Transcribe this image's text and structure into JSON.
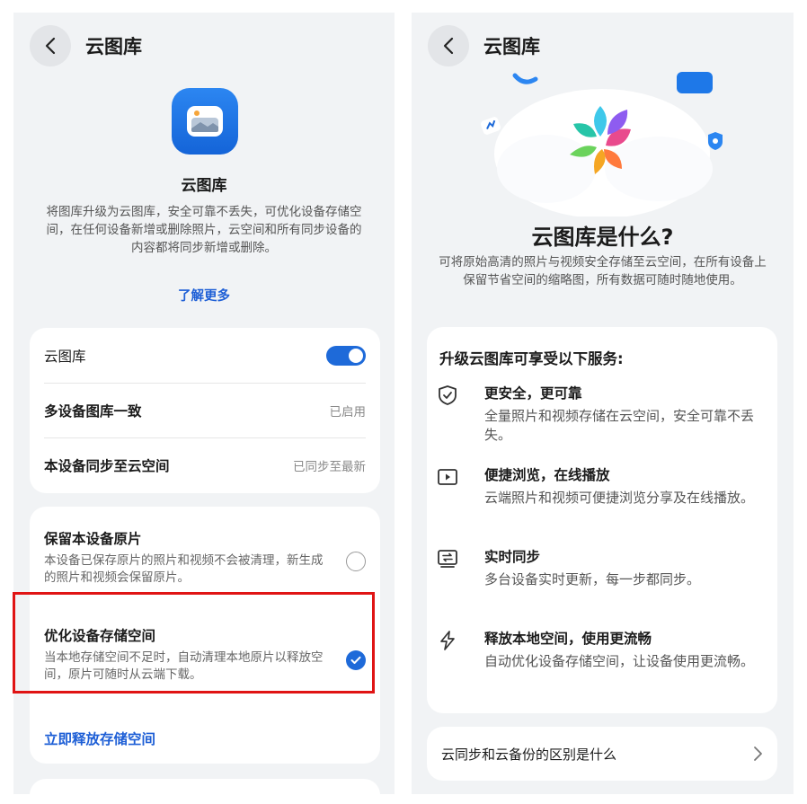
{
  "left": {
    "header": {
      "title": "云图库"
    },
    "app": {
      "name": "云图库",
      "description": "将图库升级为云图库，安全可靠不丢失，可优化设备存储空间，在任何设备新增或删除照片，云空间和所有同步设备的内容都将同步新增或删除。",
      "learn_more": "了解更多"
    },
    "settings": [
      {
        "label": "云图库",
        "toggle": "on"
      },
      {
        "label": "多设备图库一致",
        "value": "已启用"
      },
      {
        "label": "本设备同步至云空间",
        "value": "已同步至最新"
      }
    ],
    "storage_options": [
      {
        "title": "保留本设备原片",
        "desc": "本设备已保存原片的照片和视频不会被清理，新生成的照片和视频会保留原片。",
        "selected": false
      },
      {
        "title": "优化设备存储空间",
        "desc": "当本地存储空间不足时，自动清理本地原片以释放空间，原片可随时从云端下载。",
        "selected": true
      }
    ],
    "free_space_link": "立即释放存储空间",
    "accent_color": "#1e6ad9",
    "highlight_color": "#e01414"
  },
  "right": {
    "header": {
      "title": "云图库"
    },
    "hero": {
      "title": "云图库是什么?",
      "desc": "可将原始高清的照片与视频安全存储至云空间，在所有设备上保留节省空间的缩略图，所有数据可随时随地使用。"
    },
    "services_heading": "升级云图库可享受以下服务:",
    "services": [
      {
        "icon": "shield-check-icon",
        "title": "更安全，更可靠",
        "desc": "全量照片和视频存储在云空间，安全可靠不丢失。"
      },
      {
        "icon": "play-icon",
        "title": "便捷浏览，在线播放",
        "desc": "云端照片和视频可便捷浏览分享及在线播放。"
      },
      {
        "icon": "sync-icon",
        "title": "实时同步",
        "desc": "多台设备实时更新，每一步都同步。"
      },
      {
        "icon": "lightning-icon",
        "title": "释放本地空间，使用更流畅",
        "desc": "自动优化设备存储空间，让设备使用更流畅。"
      }
    ],
    "faq": {
      "label": "云同步和云备份的区别是什么"
    }
  }
}
